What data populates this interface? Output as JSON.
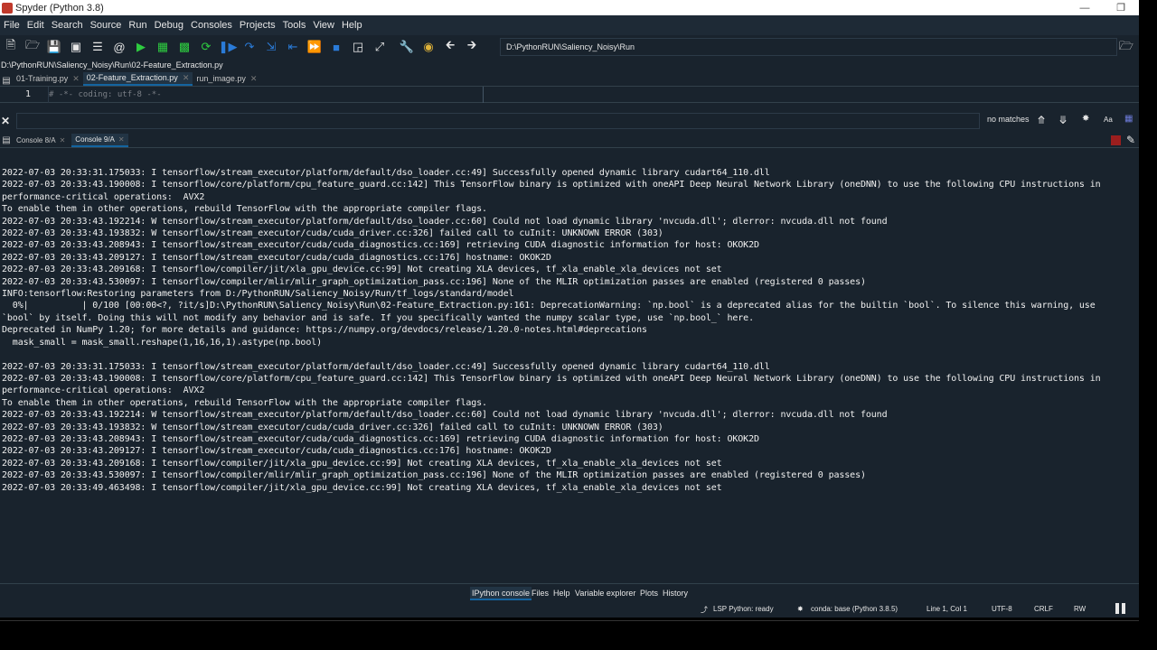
{
  "window": {
    "title": "Spyder (Python 3.8)"
  },
  "menu": [
    "File",
    "Edit",
    "Search",
    "Source",
    "Run",
    "Debug",
    "Consoles",
    "Projects",
    "Tools",
    "View",
    "Help"
  ],
  "toolbar": {
    "working_dir": "D:\\PythonRUN\\Saliency_Noisy\\Run"
  },
  "editor": {
    "file_path": "D:\\PythonRUN\\Saliency_Noisy\\Run\\02-Feature_Extraction.py",
    "tabs": [
      {
        "label": "01-Training.py"
      },
      {
        "label": "02-Feature_Extraction.py",
        "active": true
      },
      {
        "label": "run_image.py"
      }
    ],
    "line_number": "1",
    "line_text": "# -*- coding: utf-8 -*-"
  },
  "find": {
    "status": "no matches",
    "case_label": "Aa"
  },
  "console": {
    "tabs": [
      {
        "label": "Console 8/A"
      },
      {
        "label": "Console 9/A",
        "active": true
      }
    ],
    "lines": [
      "2022-07-03 20:33:31.175033: I tensorflow/stream_executor/platform/default/dso_loader.cc:49] Successfully opened dynamic library cudart64_110.dll",
      "2022-07-03 20:33:43.190008: I tensorflow/core/platform/cpu_feature_guard.cc:142] This TensorFlow binary is optimized with oneAPI Deep Neural Network Library (oneDNN) to use the following CPU instructions in",
      "performance-critical operations:  AVX2",
      "To enable them in other operations, rebuild TensorFlow with the appropriate compiler flags.",
      "2022-07-03 20:33:43.192214: W tensorflow/stream_executor/platform/default/dso_loader.cc:60] Could not load dynamic library 'nvcuda.dll'; dlerror: nvcuda.dll not found",
      "2022-07-03 20:33:43.193832: W tensorflow/stream_executor/cuda/cuda_driver.cc:326] failed call to cuInit: UNKNOWN ERROR (303)",
      "2022-07-03 20:33:43.208943: I tensorflow/stream_executor/cuda/cuda_diagnostics.cc:169] retrieving CUDA diagnostic information for host: OKOK2D",
      "2022-07-03 20:33:43.209127: I tensorflow/stream_executor/cuda/cuda_diagnostics.cc:176] hostname: OKOK2D",
      "2022-07-03 20:33:43.209168: I tensorflow/compiler/jit/xla_gpu_device.cc:99] Not creating XLA devices, tf_xla_enable_xla_devices not set",
      "2022-07-03 20:33:43.530097: I tensorflow/compiler/mlir/mlir_graph_optimization_pass.cc:196] None of the MLIR optimization passes are enabled (registered 0 passes)",
      "INFO:tensorflow:Restoring parameters from D:/PythonRUN/Saliency_Noisy/Run/tf_logs/standard/model",
      "  0%|          | 0/100 [00:00<?, ?it/s]D:\\PythonRUN\\Saliency_Noisy\\Run\\02-Feature_Extraction.py:161: DeprecationWarning: `np.bool` is a deprecated alias for the builtin `bool`. To silence this warning, use",
      "`bool` by itself. Doing this will not modify any behavior and is safe. If you specifically wanted the numpy scalar type, use `np.bool_` here.",
      "Deprecated in NumPy 1.20; for more details and guidance: https://numpy.org/devdocs/release/1.20.0-notes.html#deprecations",
      "  mask_small = mask_small.reshape(1,16,16,1).astype(np.bool)",
      "",
      "2022-07-03 20:33:31.175033: I tensorflow/stream_executor/platform/default/dso_loader.cc:49] Successfully opened dynamic library cudart64_110.dll",
      "2022-07-03 20:33:43.190008: I tensorflow/core/platform/cpu_feature_guard.cc:142] This TensorFlow binary is optimized with oneAPI Deep Neural Network Library (oneDNN) to use the following CPU instructions in",
      "performance-critical operations:  AVX2",
      "To enable them in other operations, rebuild TensorFlow with the appropriate compiler flags.",
      "2022-07-03 20:33:43.192214: W tensorflow/stream_executor/platform/default/dso_loader.cc:60] Could not load dynamic library 'nvcuda.dll'; dlerror: nvcuda.dll not found",
      "2022-07-03 20:33:43.193832: W tensorflow/stream_executor/cuda/cuda_driver.cc:326] failed call to cuInit: UNKNOWN ERROR (303)",
      "2022-07-03 20:33:43.208943: I tensorflow/stream_executor/cuda/cuda_diagnostics.cc:169] retrieving CUDA diagnostic information for host: OKOK2D",
      "2022-07-03 20:33:43.209127: I tensorflow/stream_executor/cuda/cuda_diagnostics.cc:176] hostname: OKOK2D",
      "2022-07-03 20:33:43.209168: I tensorflow/compiler/jit/xla_gpu_device.cc:99] Not creating XLA devices, tf_xla_enable_xla_devices not set",
      "2022-07-03 20:33:43.530097: I tensorflow/compiler/mlir/mlir_graph_optimization_pass.cc:196] None of the MLIR optimization passes are enabled (registered 0 passes)",
      "2022-07-03 20:33:49.463498: I tensorflow/compiler/jit/xla_gpu_device.cc:99] Not creating XLA devices, tf_xla_enable_xla_devices not set"
    ]
  },
  "panes": [
    "IPython console",
    "Files",
    "Help",
    "Variable explorer",
    "Plots",
    "History"
  ],
  "status": {
    "lsp": "LSP Python: ready",
    "conda": "conda: base (Python 3.8.5)",
    "position": "Line 1, Col 1",
    "encoding": "UTF-8",
    "eol": "CRLF",
    "permissions": "RW"
  },
  "colors": {
    "background": "#19232d",
    "accent": "#1464a0",
    "text": "#f0f0f0"
  },
  "icons": [
    "new-file-icon",
    "open-folder-icon",
    "save-icon",
    "save-all-icon",
    "outline-icon",
    "at-icon",
    "run-icon",
    "run-cell-icon",
    "run-cell-advance-icon",
    "rerun-icon",
    "run-selection-icon",
    "debug-icon",
    "stop-icon",
    "maximize-icon",
    "fullscreen-icon",
    "wrench-icon",
    "python-path-icon",
    "back-icon",
    "forward-icon",
    "browse-folder-icon",
    "close-icon",
    "find-previous-icon",
    "find-next-icon",
    "regex-icon",
    "pause-icon"
  ]
}
